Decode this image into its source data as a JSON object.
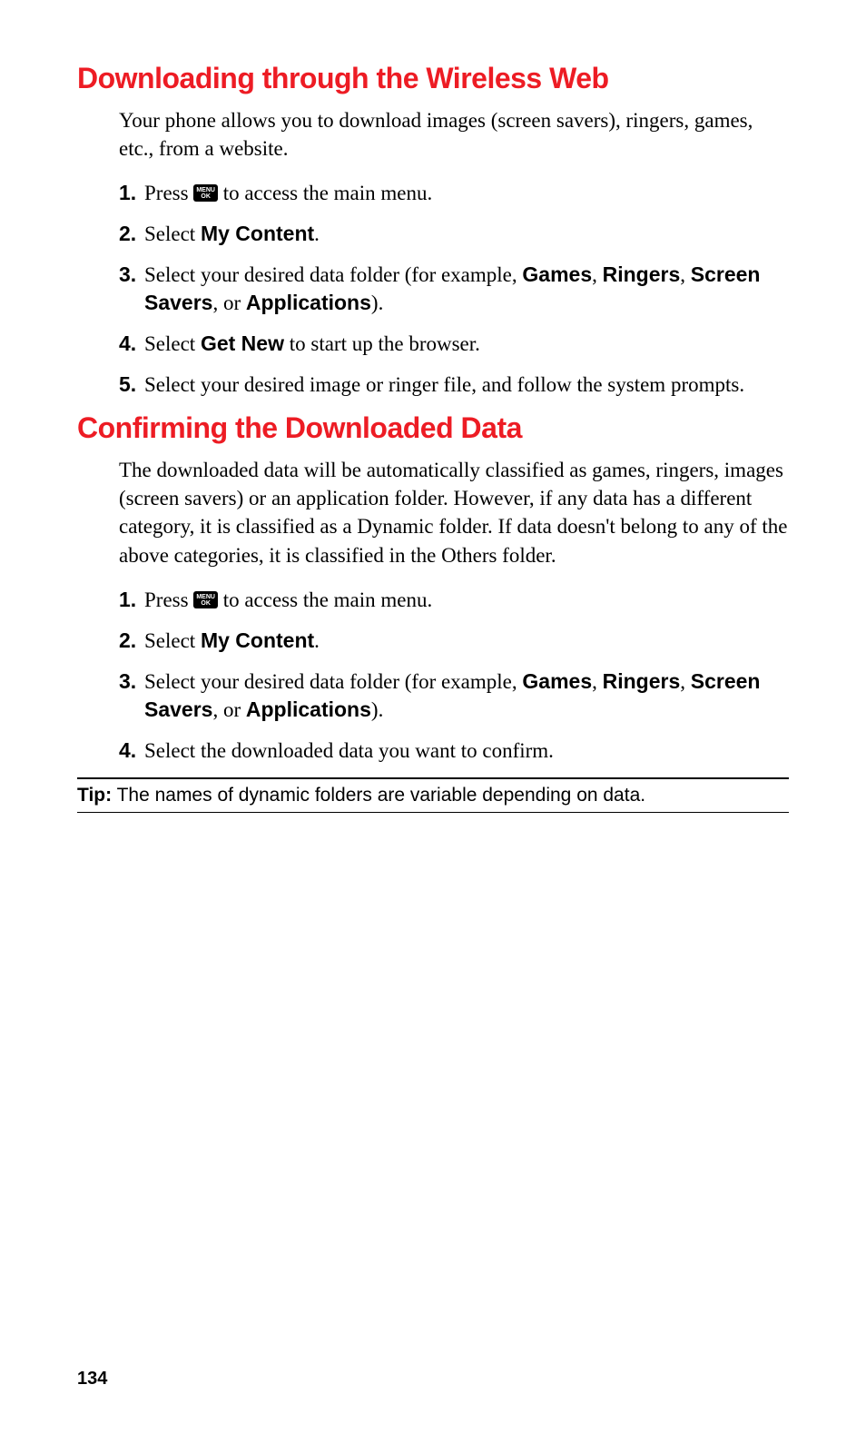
{
  "section1": {
    "heading": "Downloading through the Wireless Web",
    "intro": "Your phone allows you to download images (screen savers), ringers, games, etc., from a website.",
    "steps": [
      {
        "num": "1.",
        "pre": "Press ",
        "icon_top": "MENU",
        "icon_bot": "OK",
        "post": " to access the main menu."
      },
      {
        "num": "2.",
        "pre": "Select ",
        "b1": "My Content",
        "post": "."
      },
      {
        "num": "3.",
        "pre": "Select your desired data folder (for example, ",
        "b1": "Games",
        "mid1": ", ",
        "b2": "Ringers",
        "mid2": ", ",
        "b3": "Screen Savers",
        "mid3": ", or ",
        "b4": "Applications",
        "post": ")."
      },
      {
        "num": "4.",
        "pre": "Select ",
        "b1": "Get New",
        "post": " to start up the browser."
      },
      {
        "num": "5.",
        "pre": "Select your desired image or ringer file, and follow the system prompts."
      }
    ]
  },
  "section2": {
    "heading": "Confirming the Downloaded Data",
    "intro": "The downloaded data will be automatically classified as games, ringers, images (screen savers) or an application folder. However, if any data has a different category, it is classified as a Dynamic folder. If data doesn't belong to any of the above categories, it is classified in the Others folder.",
    "steps": [
      {
        "num": "1.",
        "pre": "Press ",
        "icon_top": "MENU",
        "icon_bot": "OK",
        "post": " to access the main menu."
      },
      {
        "num": "2.",
        "pre": "Select ",
        "b1": "My Content",
        "post": "."
      },
      {
        "num": "3.",
        "pre": "Select your desired data folder (for example, ",
        "b1": "Games",
        "mid1": ", ",
        "b2": "Ringers",
        "mid2": ", ",
        "b3": "Screen Savers",
        "mid3": ", or ",
        "b4": "Applications",
        "post": ")."
      },
      {
        "num": "4.",
        "pre": "Select the downloaded data you want to confirm."
      }
    ]
  },
  "tip": {
    "label": "Tip:",
    "text": " The names of dynamic folders are variable depending on data."
  },
  "page_number": "134"
}
